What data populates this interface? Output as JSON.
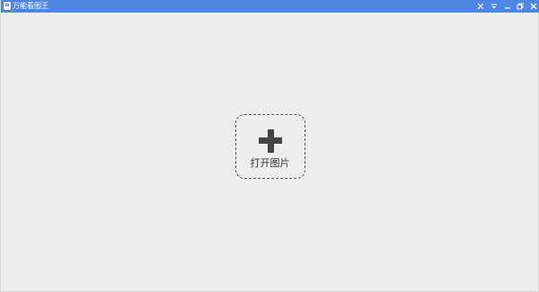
{
  "window": {
    "title": "万能看图王",
    "accent_color": "#4f86e0",
    "background_color": "#ededed"
  },
  "titlebar_buttons": [
    {
      "name": "close-alt",
      "icon": "x-icon"
    },
    {
      "name": "menu",
      "icon": "dropdown-menu-icon"
    },
    {
      "name": "minimize",
      "icon": "minimize-icon"
    },
    {
      "name": "maximize",
      "icon": "restore-icon"
    },
    {
      "name": "close",
      "icon": "close-icon"
    }
  ],
  "main": {
    "open_button": {
      "icon": "plus-icon",
      "label": "打开图片"
    }
  }
}
